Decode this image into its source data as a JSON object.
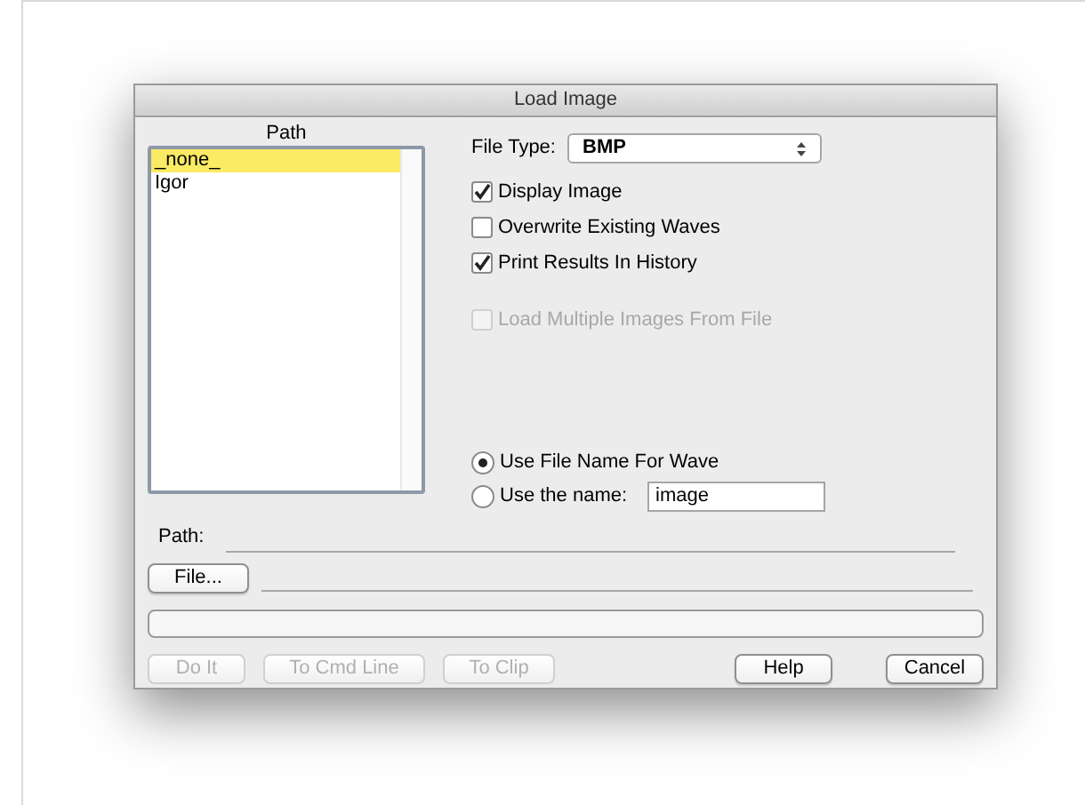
{
  "window": {
    "title": "Load Image"
  },
  "path_list": {
    "heading": "Path",
    "items": [
      {
        "label": "_none_",
        "selected": true
      },
      {
        "label": "Igor",
        "selected": false
      }
    ]
  },
  "file_type": {
    "label": "File Type:",
    "value": "BMP"
  },
  "options": [
    {
      "label": "Display Image",
      "checked": true,
      "disabled": false
    },
    {
      "label": "Overwrite Existing Waves",
      "checked": false,
      "disabled": false
    },
    {
      "label": "Print Results In History",
      "checked": true,
      "disabled": false
    },
    {
      "label": "Load Multiple Images From File",
      "checked": false,
      "disabled": true
    }
  ],
  "naming": [
    {
      "label": "Use File Name For Wave",
      "selected": true
    },
    {
      "label": "Use the name:",
      "selected": false,
      "value": "image"
    }
  ],
  "path_label": "Path:",
  "file_button": "File...",
  "buttons_left": [
    {
      "label": "Do It",
      "disabled": true
    },
    {
      "label": "To Cmd Line",
      "disabled": true
    },
    {
      "label": "To Clip",
      "disabled": true
    }
  ],
  "buttons_right": [
    {
      "label": "Help",
      "disabled": false
    },
    {
      "label": "Cancel",
      "disabled": false
    }
  ]
}
